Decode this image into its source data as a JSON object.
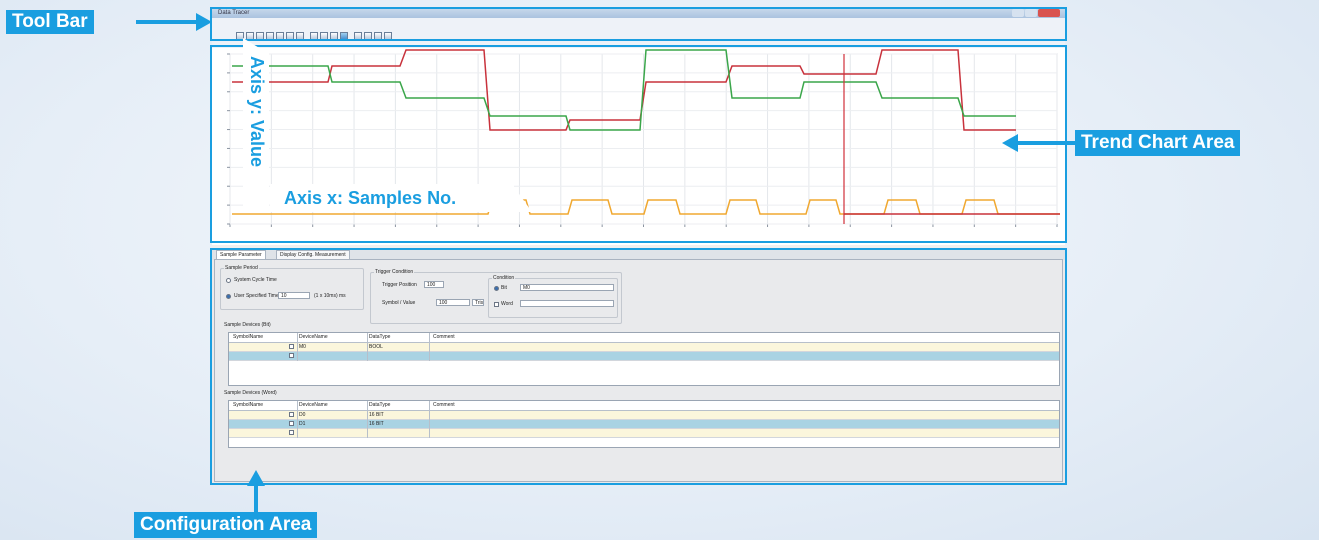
{
  "annotations": {
    "toolbar": "Tool Bar",
    "trend_chart": "Trend Chart Area",
    "axis_y": "Axis y: Value",
    "axis_x": "Axis x: Samples No.",
    "configuration": "Configuration Area"
  },
  "colors": {
    "accent": "#1a9ee0",
    "trend_red": "#c8323c",
    "trend_green": "#3aa64a",
    "trend_orange": "#f0a830",
    "cursor": "#d0303a",
    "row_cream": "#fbf6dc",
    "row_selected": "#a9d3e3"
  },
  "toolbar": {
    "icons": [
      "stop-icon",
      "run-icon",
      "record-icon",
      "reset-icon",
      "cursor-icon",
      "zoom-x-icon",
      "zoom-y-icon",
      "fit-icon",
      "grid-icon",
      "marker-icon",
      "pen-icon",
      "settings-icon",
      "print-icon",
      "save-icon",
      "export-icon"
    ]
  },
  "chart": {
    "y_ticks": [
      "",
      "",
      "",
      "",
      "",
      "",
      "",
      "",
      "",
      ""
    ],
    "x_ticks": [
      "",
      "",
      "",
      "",
      "",
      "",
      "",
      "",
      "",
      "",
      "",
      "",
      "",
      "",
      "",
      "",
      "",
      "",
      "",
      "",
      ""
    ]
  },
  "config": {
    "tabs": [
      "Sample Parameter",
      "Display Config. Measurement"
    ],
    "sample_period": {
      "title": "Sample Period",
      "option_cycle": "System Cycle Time",
      "option_user": "User Specified Time",
      "user_value": "10",
      "user_unit": "(1 x 10ms) ms"
    },
    "trigger": {
      "title": "Trigger Condition",
      "position_label": "Trigger Position",
      "position_value": "100",
      "symbol_label": "Symbol / Value",
      "symbol_value": "100",
      "op_label": "Tris"
    },
    "condition": {
      "title": "Condition",
      "option_bit": "Bit",
      "bit_value": "M0",
      "option_word": "Word"
    },
    "bit_grid": {
      "title": "Sample Devices (Bit)",
      "headers": [
        "SymbolName",
        "DeviceName",
        "DataType",
        "Comment"
      ],
      "rows": [
        {
          "symbol": "",
          "device": "M0",
          "type": "BOOL",
          "comment": ""
        },
        {
          "symbol": "",
          "device": "",
          "type": "",
          "comment": ""
        }
      ]
    },
    "word_grid": {
      "title": "Sample Devices (Word)",
      "headers": [
        "SymbolName",
        "DeviceName",
        "DataType",
        "Comment"
      ],
      "rows": [
        {
          "symbol": "",
          "device": "D0",
          "type": "16 BIT",
          "comment": ""
        },
        {
          "symbol": "",
          "device": "D1",
          "type": "16 BIT",
          "comment": ""
        },
        {
          "symbol": "",
          "device": "",
          "type": "",
          "comment": ""
        }
      ]
    }
  }
}
